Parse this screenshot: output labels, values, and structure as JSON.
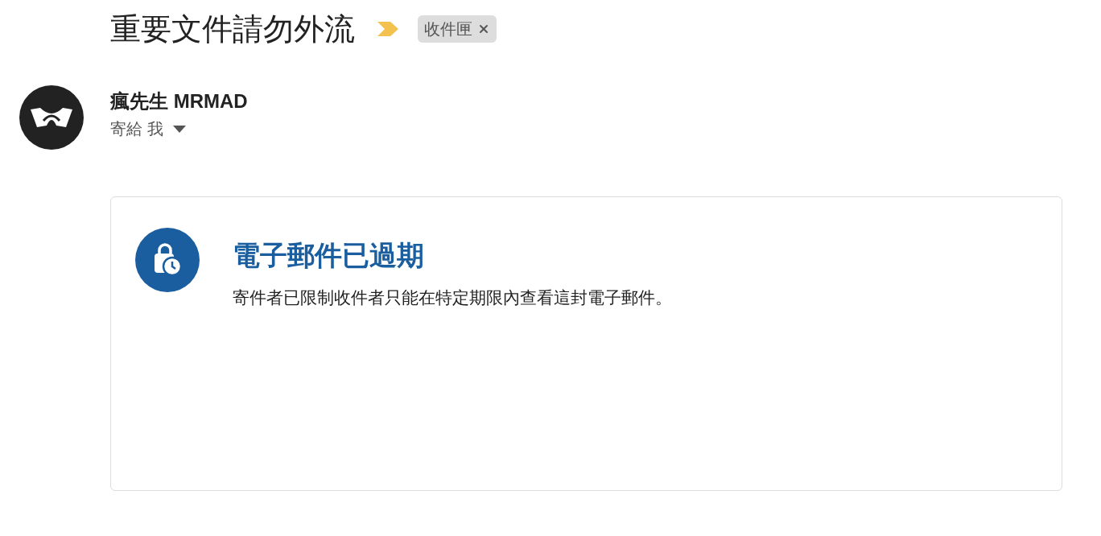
{
  "subject": "重要文件請勿外流",
  "important": true,
  "labels": [
    {
      "text": "收件匣"
    }
  ],
  "sender": {
    "name": "瘋先生 MRMAD",
    "recipient": "寄給 我"
  },
  "notice": {
    "title": "電子郵件已過期",
    "body": "寄件者已限制收件者只能在特定期限內查看這封電子郵件。"
  }
}
